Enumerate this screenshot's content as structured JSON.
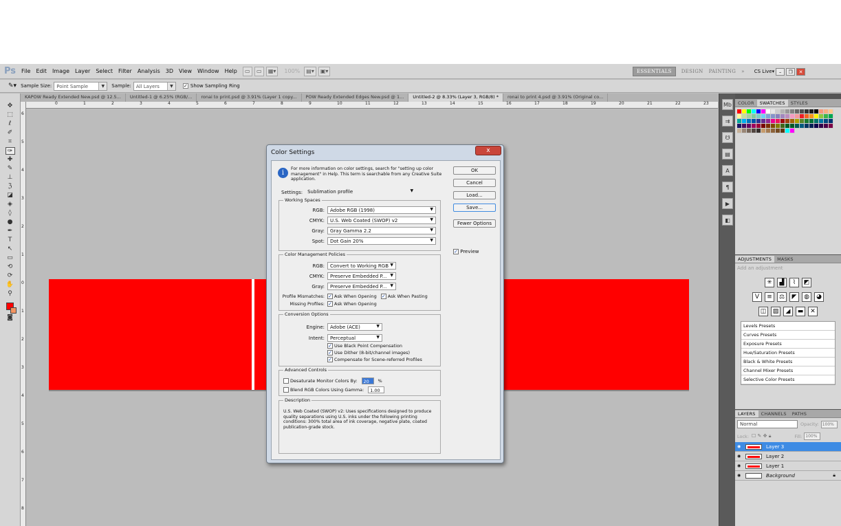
{
  "app": {
    "logo": "Ps",
    "menus": [
      "File",
      "Edit",
      "Image",
      "Layer",
      "Select",
      "Filter",
      "Analysis",
      "3D",
      "View",
      "Window",
      "Help"
    ],
    "zoom": "100%",
    "workspaces": [
      "ESSENTIALS",
      "DESIGN",
      "PAINTING"
    ],
    "more": "»",
    "cs_live": "CS Live▾"
  },
  "options": {
    "sample_size_label": "Sample Size:",
    "sample_size_value": "Point Sample",
    "sample_label": "Sample:",
    "sample_value": "All Layers",
    "show_ring_label": "Show Sampling Ring"
  },
  "tabs": [
    "KAPOW Ready Extended New.psd @ 12.5...",
    "Untitled-1 @ 6.25% (RGB/...",
    "ronai to print.psd @ 3.91% (Layer 1 copy...",
    "POW Ready Extended Edges New.psd @ 1...",
    "Untitled-2 @ 8.33% (Layer 3, RGB/8) *",
    "ronai to print 4.psd @ 3.91% (Original co..."
  ],
  "ruler_h": [
    "0",
    "1",
    "2",
    "3",
    "4",
    "5",
    "6",
    "7",
    "8",
    "9",
    "10",
    "11",
    "12",
    "13",
    "14",
    "15",
    "16",
    "17",
    "18",
    "19",
    "20",
    "21",
    "22",
    "23"
  ],
  "ruler_v": [
    "6",
    "5",
    "4",
    "3",
    "2",
    "1",
    "0",
    "1",
    "2",
    "3",
    "4",
    "5",
    "6",
    "7",
    "8"
  ],
  "panels": {
    "swatch_tabs": [
      "COLOR",
      "SWATCHES",
      "STYLES"
    ],
    "adjust_tabs": [
      "ADJUSTMENTS",
      "MASKS"
    ],
    "adjust_hint": "Add an adjustment",
    "presets": [
      "Levels Presets",
      "Curves Presets",
      "Exposure Presets",
      "Hue/Saturation Presets",
      "Black & White Presets",
      "Channel Mixer Presets",
      "Selective Color Presets"
    ],
    "layer_tabs": [
      "LAYERS",
      "CHANNELS",
      "PATHS"
    ],
    "blend_mode": "Normal",
    "opacity_label": "Opacity:",
    "opacity_value": "100%",
    "lock_label": "Lock:",
    "fill_label": "Fill:",
    "fill_value": "100%",
    "layers": [
      "Layer 3",
      "Layer 2",
      "Layer 1",
      "Background"
    ]
  },
  "dialog": {
    "title": "Color Settings",
    "close": "x",
    "info": "For more information on color settings, search for \"setting up color management\" in Help. This term is searchable from any Creative Suite application.",
    "buttons": {
      "ok": "OK",
      "cancel": "Cancel",
      "load": "Load...",
      "save": "Save...",
      "fewer": "Fewer Options"
    },
    "preview_label": "Preview",
    "settings_label": "Settings:",
    "settings_value": "Sublimation profile",
    "working_spaces": {
      "title": "Working Spaces",
      "rgb_label": "RGB:",
      "rgb": "Adobe RGB (1998)",
      "cmyk_label": "CMYK:",
      "cmyk": "U.S. Web Coated (SWOP) v2",
      "gray_label": "Gray:",
      "gray": "Gray Gamma 2.2",
      "spot_label": "Spot:",
      "spot": "Dot Gain 20%"
    },
    "policies": {
      "title": "Color Management Policies",
      "rgb_label": "RGB:",
      "rgb": "Convert to Working RGB",
      "cmyk_label": "CMYK:",
      "cmyk": "Preserve Embedded P...",
      "gray_label": "Gray:",
      "gray": "Preserve Embedded P...",
      "mismatch_label": "Profile Mismatches:",
      "mismatch_open": "Ask When Opening",
      "mismatch_paste": "Ask When Pasting",
      "missing_label": "Missing Profiles:",
      "missing_open": "Ask When Opening"
    },
    "conversion": {
      "title": "Conversion Options",
      "engine_label": "Engine:",
      "engine": "Adobe (ACE)",
      "intent_label": "Intent:",
      "intent": "Perceptual",
      "bpc": "Use Black Point Compensation",
      "dither": "Use Dither (8-bit/channel images)",
      "scene": "Compensate for Scene-referred Profiles"
    },
    "advanced": {
      "title": "Advanced Controls",
      "desat_label": "Desaturate Monitor Colors By:",
      "desat_value": "20",
      "desat_unit": "%",
      "blend_label": "Blend RGB Colors Using Gamma:",
      "blend_value": "1.00"
    },
    "description": {
      "title": "Description",
      "text": "U.S. Web Coated (SWOP) v2: Uses specifications designed to produce quality separations using U.S. inks under the following printing conditions: 300% total area of ink coverage, negative plate, coated publication-grade stock."
    }
  },
  "colors": {
    "accent": "#3d8be4",
    "foreground": "#ff0000",
    "background_swatch": "#f39461",
    "canvas_red": "#ff0000"
  }
}
